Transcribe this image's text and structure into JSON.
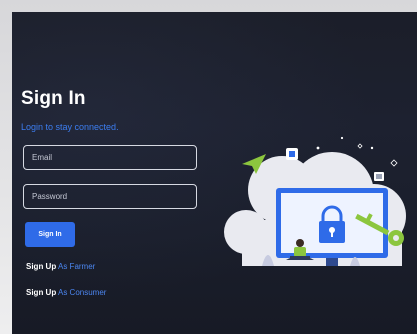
{
  "signin": {
    "title": "Sign In",
    "subtitle": "Login to stay connected.",
    "email": {
      "placeholder": "Email",
      "value": ""
    },
    "password": {
      "placeholder": "Password",
      "value": ""
    },
    "button_label": "Sign In",
    "signup_links": [
      {
        "strong": "Sign Up",
        "role": "As Farmer"
      },
      {
        "strong": "Sign Up",
        "role": "As Consumer"
      }
    ]
  },
  "colors": {
    "background": "#1c2030",
    "accent": "#2f6be8",
    "link": "#4b86f0",
    "text": "#ffffff"
  },
  "icons": {
    "illustration": "security-lock-illustration",
    "lock": "lock-icon",
    "key": "key-icon",
    "paper_plane": "paper-plane-icon"
  }
}
